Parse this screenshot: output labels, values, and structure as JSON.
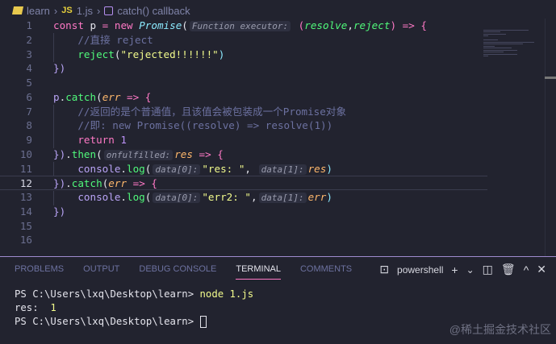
{
  "breadcrumb": {
    "folder": "learn",
    "file_badge": "JS",
    "file": "1.js",
    "symbol": "catch() callback"
  },
  "editor": {
    "active_line": 12,
    "lines": [
      [
        {
          "t": "const",
          "c": "kw"
        },
        {
          "t": " p ",
          "c": "var"
        },
        {
          "t": "=",
          "c": "kw"
        },
        {
          "t": " ",
          "c": "var"
        },
        {
          "t": "new",
          "c": "kw"
        },
        {
          "t": " ",
          "c": "var"
        },
        {
          "t": "Promise",
          "c": "cls"
        },
        {
          "t": "(",
          "c": "pun"
        },
        {
          "t": "Function executor:",
          "c": "hint"
        },
        {
          "t": " (",
          "c": "par"
        },
        {
          "t": "resolve",
          "c": "prm"
        },
        {
          "t": ",",
          "c": "pun"
        },
        {
          "t": "reject",
          "c": "prm"
        },
        {
          "t": ") ",
          "c": "par"
        },
        {
          "t": "=>",
          "c": "kw"
        },
        {
          "t": " {",
          "c": "par"
        }
      ],
      [
        {
          "t": "    //直接 reject",
          "c": "cm"
        }
      ],
      [
        {
          "t": "    ",
          "c": "var"
        },
        {
          "t": "reject",
          "c": "fn"
        },
        {
          "t": "(",
          "c": "pun"
        },
        {
          "t": "\"rejected!!!!!!\"",
          "c": "str"
        },
        {
          "t": ")",
          "c": "br"
        }
      ],
      [
        {
          "t": "})",
          "c": "obj"
        }
      ],
      [],
      [
        {
          "t": "p",
          "c": "obj"
        },
        {
          "t": ".",
          "c": "pun"
        },
        {
          "t": "catch",
          "c": "fn"
        },
        {
          "t": "(",
          "c": "pun"
        },
        {
          "t": "err",
          "c": "err"
        },
        {
          "t": " => {",
          "c": "kw"
        }
      ],
      [
        {
          "t": "    //返回的是个普通值，且该值会被包装成一个Promise对象",
          "c": "cm"
        }
      ],
      [
        {
          "t": "    //即: new Promise((resolve) => resolve(1))",
          "c": "cm"
        }
      ],
      [
        {
          "t": "    ",
          "c": "var"
        },
        {
          "t": "return",
          "c": "kw"
        },
        {
          "t": " 1",
          "c": "num"
        }
      ],
      [
        {
          "t": "})",
          "c": "obj"
        },
        {
          "t": ".",
          "c": "pun"
        },
        {
          "t": "then",
          "c": "fn"
        },
        {
          "t": "(",
          "c": "pun"
        },
        {
          "t": "onfulfilled:",
          "c": "hint"
        },
        {
          "t": "res",
          "c": "err"
        },
        {
          "t": " => {",
          "c": "kw"
        }
      ],
      [
        {
          "t": "    ",
          "c": "var"
        },
        {
          "t": "console",
          "c": "obj"
        },
        {
          "t": ".",
          "c": "pun"
        },
        {
          "t": "log",
          "c": "fn"
        },
        {
          "t": "(",
          "c": "pun"
        },
        {
          "t": "data[0]:",
          "c": "hint"
        },
        {
          "t": "\"res: \"",
          "c": "str"
        },
        {
          "t": ", ",
          "c": "pun"
        },
        {
          "t": "data[1]:",
          "c": "hint"
        },
        {
          "t": "res",
          "c": "err"
        },
        {
          "t": ")",
          "c": "br"
        }
      ],
      [
        {
          "t": "})",
          "c": "obj"
        },
        {
          "t": ".",
          "c": "pun"
        },
        {
          "t": "catch",
          "c": "fn"
        },
        {
          "t": "(",
          "c": "pun"
        },
        {
          "t": "err",
          "c": "err"
        },
        {
          "t": " => {",
          "c": "kw"
        }
      ],
      [
        {
          "t": "    ",
          "c": "var"
        },
        {
          "t": "console",
          "c": "obj"
        },
        {
          "t": ".",
          "c": "pun"
        },
        {
          "t": "log",
          "c": "fn"
        },
        {
          "t": "(",
          "c": "pun"
        },
        {
          "t": "data[0]:",
          "c": "hint"
        },
        {
          "t": "\"err2: \"",
          "c": "str"
        },
        {
          "t": ",",
          "c": "pun"
        },
        {
          "t": "data[1]:",
          "c": "hint"
        },
        {
          "t": "err",
          "c": "err"
        },
        {
          "t": ")",
          "c": "br"
        }
      ],
      [
        {
          "t": "})",
          "c": "obj"
        }
      ],
      [],
      []
    ]
  },
  "panel": {
    "tabs": [
      "PROBLEMS",
      "OUTPUT",
      "DEBUG CONSOLE",
      "TERMINAL",
      "COMMENTS"
    ],
    "active_tab": 3,
    "shell": "powershell"
  },
  "terminal": {
    "prompt1": "PS C:\\Users\\lxq\\Desktop\\learn> ",
    "cmd": "node 1.js",
    "out_label": "res:  ",
    "out_value": "1",
    "prompt2": "PS C:\\Users\\lxq\\Desktop\\learn> "
  },
  "watermark": "@稀土掘金技术社区",
  "colors": {
    "background": "#22232f",
    "keyword": "#ff79c6",
    "string": "#f1fa8c",
    "function": "#50fa7b",
    "comment": "#6c71a0"
  }
}
